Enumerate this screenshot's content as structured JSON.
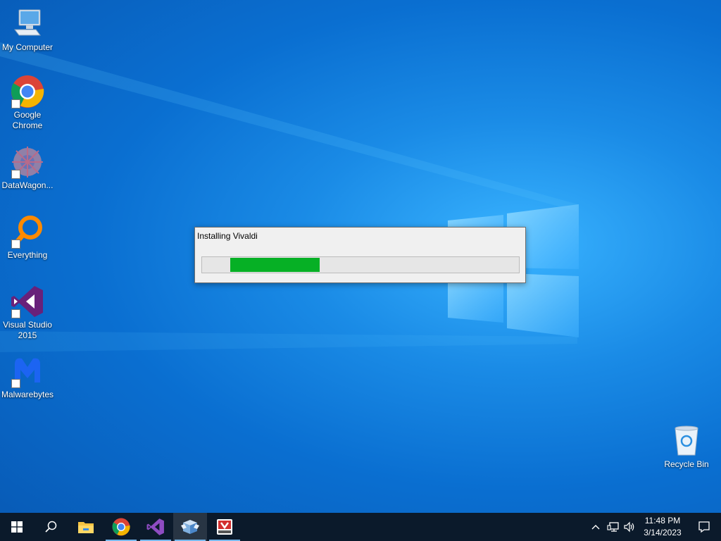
{
  "desktop": {
    "icons": [
      {
        "label": "My Computer",
        "icon": "computer-icon"
      },
      {
        "label": "Google Chrome",
        "icon": "chrome-icon"
      },
      {
        "label": "DataWagon...",
        "icon": "datawagon-icon"
      },
      {
        "label": "Everything",
        "icon": "everything-icon"
      },
      {
        "label": "Visual Studio 2015",
        "icon": "visual-studio-icon"
      },
      {
        "label": "Malwarebytes",
        "icon": "malwarebytes-icon"
      },
      {
        "label": "Recycle Bin",
        "icon": "recycle-bin-icon"
      }
    ]
  },
  "dialog": {
    "title": "Installing Vivaldi",
    "progress_percent": 31,
    "progress_color": "#06b025"
  },
  "taskbar": {
    "buttons": [
      {
        "icon": "windows-start-icon"
      },
      {
        "icon": "search-icon"
      },
      {
        "icon": "file-explorer-icon"
      },
      {
        "icon": "chrome-icon"
      },
      {
        "icon": "visual-studio-icon"
      },
      {
        "icon": "installer-icon"
      },
      {
        "icon": "vivaldi-installer-icon"
      }
    ],
    "tray": {
      "time": "11:48 PM",
      "date": "3/14/2023"
    }
  }
}
